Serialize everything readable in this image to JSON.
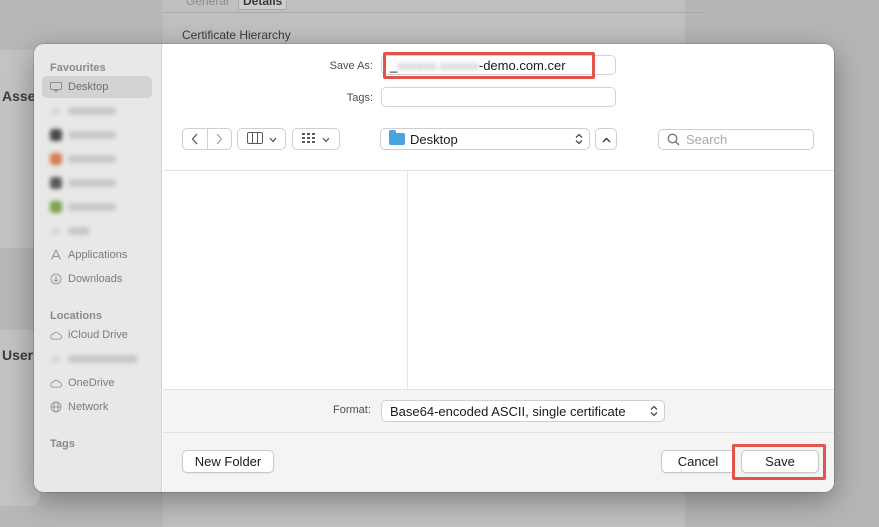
{
  "background": {
    "tabs": [
      "General",
      "Details"
    ],
    "active_tab": "Details",
    "section_title": "Certificate Hierarchy",
    "left_labels": [
      "Asse",
      "User"
    ]
  },
  "dialog": {
    "save_as_label": "Save As:",
    "save_as_value_prefix": "_",
    "save_as_value_redacted": "xxxxxx.xxxxxx",
    "save_as_value_suffix": "-demo.com.cer",
    "tags_label": "Tags:",
    "tags_value": "",
    "location": "Desktop",
    "search_placeholder": "Search",
    "format_label": "Format:",
    "format_value": "Base64-encoded ASCII, single certificate",
    "new_folder_label": "New Folder",
    "cancel_label": "Cancel",
    "save_label": "Save"
  },
  "sidebar": {
    "favourites_header": "Favourites",
    "favourites": [
      {
        "label": "Desktop",
        "icon": "desktop-icon",
        "selected": true
      },
      {
        "label": "Redacted",
        "icon": "folder-icon",
        "redacted": true
      },
      {
        "label": "Redacted",
        "icon": "app-icon",
        "redacted": true
      },
      {
        "label": "Redacted",
        "icon": "app-icon",
        "redacted": true
      },
      {
        "label": "Redacted",
        "icon": "app-icon",
        "redacted": true
      },
      {
        "label": "Redacted",
        "icon": "app-icon",
        "redacted": true
      },
      {
        "label": "Redacted",
        "icon": "folder-icon",
        "redacted": true
      },
      {
        "label": "Applications",
        "icon": "applications-icon"
      },
      {
        "label": "Downloads",
        "icon": "downloads-icon"
      }
    ],
    "locations_header": "Locations",
    "locations": [
      {
        "label": "iCloud Drive",
        "icon": "cloud-icon"
      },
      {
        "label": "Redacted",
        "icon": "computer-icon",
        "redacted": true
      },
      {
        "label": "OneDrive",
        "icon": "cloud-icon"
      },
      {
        "label": "Network",
        "icon": "globe-icon"
      }
    ],
    "tags_header": "Tags"
  },
  "colors": {
    "highlight": "#e0544b",
    "folder": "#4aa3df",
    "sidebar_bg": "#e8e8e8"
  }
}
